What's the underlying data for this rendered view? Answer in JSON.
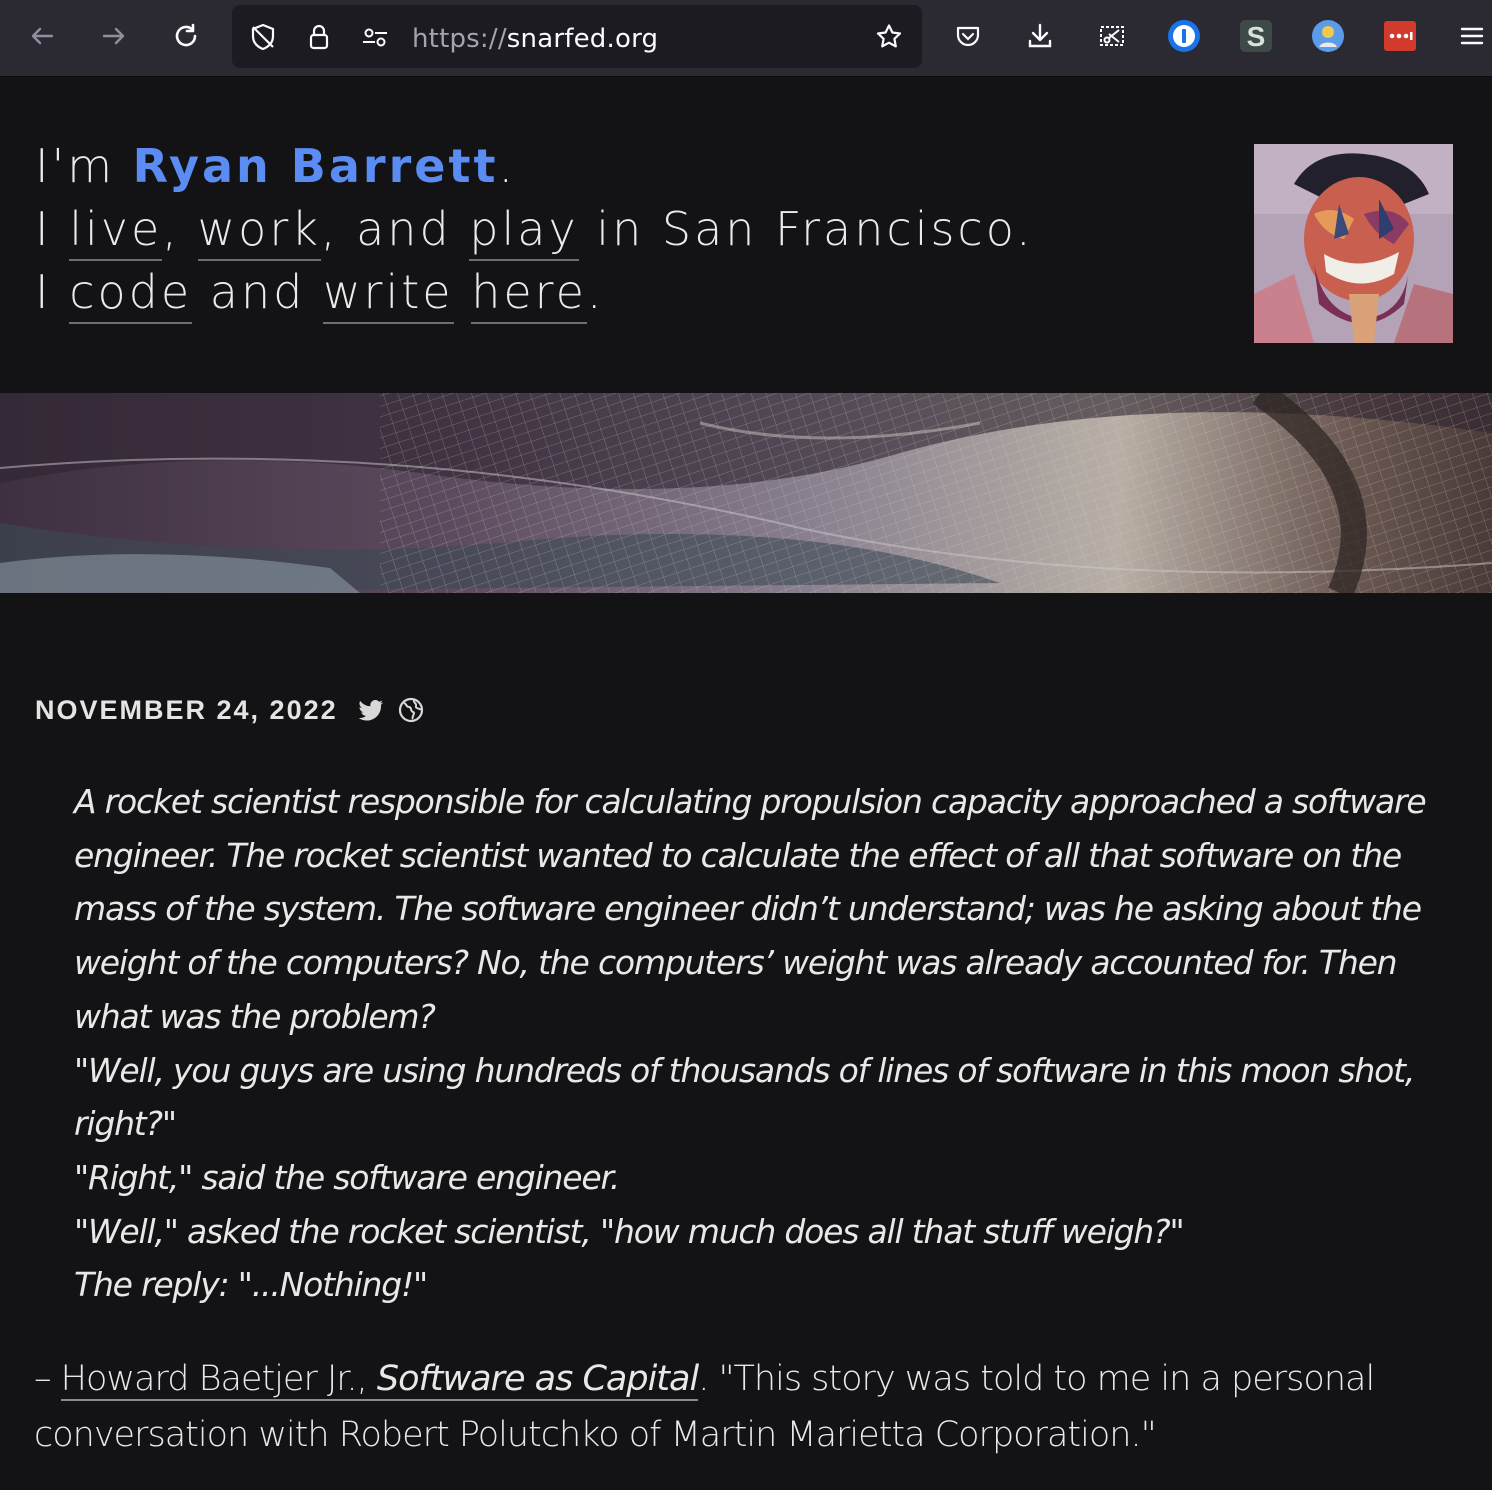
{
  "browser": {
    "url_scheme": "https://",
    "url_host": "snarfed.org",
    "icons": [
      "back-arrow-icon",
      "forward-arrow-icon",
      "reload-icon",
      "tracking-protection-icon",
      "lock-icon",
      "permissions-icon",
      "bookmark-star-icon",
      "pocket-icon",
      "download-icon",
      "screenshot-icon",
      "1password-icon",
      "s-extension-icon",
      "extension-icon",
      "red-extension-icon",
      "menu-icon"
    ]
  },
  "hero": {
    "l1_pre": "I'm ",
    "name": "Ryan Barrett",
    "l1_post": ".",
    "l2_pre": "I ",
    "live": "live",
    "comma1": ", ",
    "work": "work",
    "comma2": ", and ",
    "play": "play",
    "l2_post": " in San Francisco.",
    "l3_pre": "I ",
    "code": "code",
    "and": " and ",
    "write": "write",
    "space": " ",
    "here": "here",
    "l3_post": "."
  },
  "post": {
    "date": "NOVEMBER 24, 2022",
    "quote": [
      "A rocket scientist responsible for calculating propulsion capacity approached a software engineer. The rocket scientist wanted to calculate the effect of all that software on the mass of the system. The software engineer didn’t understand; was he asking about the weight of the computers? No, the computers’ weight was already accounted for. Then what was the problem?",
      "\"Well, you guys are using hundreds of thousands of lines of software in this moon shot, right?\"",
      "\"Right,\" said the software engineer.",
      "\"Well,\" asked the rocket scientist, \"how much does all that stuff weigh?\"",
      "The reply: \"...Nothing!\""
    ],
    "attribution": {
      "dash": "– ",
      "author": "Howard Baetjer Jr.",
      "sep": ", ",
      "book": "Software as Capital",
      "rest": ". \"This story was told to me in a personal conversation with Robert Polutchko of Martin Marietta Corporation.\""
    }
  }
}
